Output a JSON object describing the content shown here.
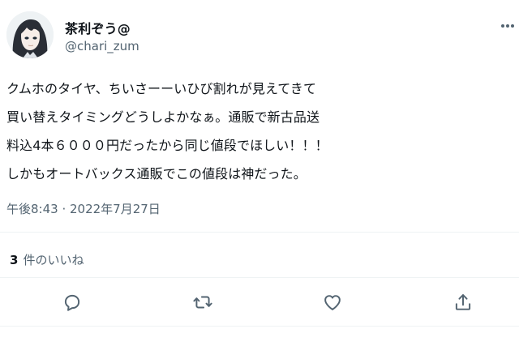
{
  "user": {
    "display_name": "茶利ぞう@",
    "handle": "@chari_zum",
    "avatar_icon": "anime-girl-avatar"
  },
  "tweet": {
    "lines": [
      "クムホのタイヤ、ちいさーーいひび割れが見えてきて",
      "買い替えタイミングどうしよかなぁ。通販で新古品送",
      "料込4本６０００円だったから同じ値段でほしい！！！",
      "しかもオートバックス通販でこの値段は神だった。"
    ],
    "timestamp": "午後8:43 · 2022年7月27日"
  },
  "stats": {
    "like_count": "3",
    "like_label": "件のいいね"
  },
  "actions": {
    "icons": [
      "reply-icon",
      "retweet-icon",
      "like-icon",
      "share-icon"
    ]
  },
  "colors": {
    "text": "#0f1419",
    "secondary": "#536471",
    "divider": "#eff3f4"
  }
}
